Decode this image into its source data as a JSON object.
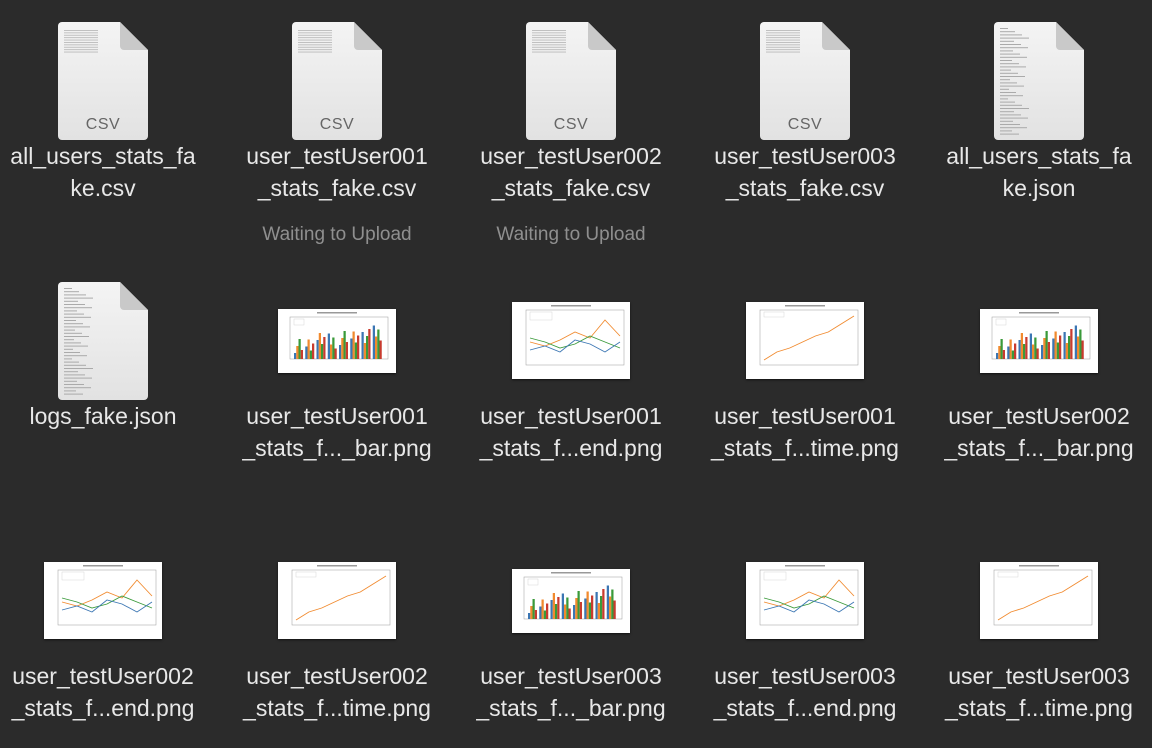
{
  "files": [
    {
      "line1": "all_users_stats_fa",
      "line2": "ke.csv",
      "kind": "csv",
      "ext": "CSV",
      "status": ""
    },
    {
      "line1": "user_testUser001",
      "line2": "_stats_fake.csv",
      "kind": "csv",
      "ext": "CSV",
      "status": "Waiting to Upload"
    },
    {
      "line1": "user_testUser002",
      "line2": "_stats_fake.csv",
      "kind": "csv",
      "ext": "CSV",
      "status": "Waiting to Upload"
    },
    {
      "line1": "user_testUser003",
      "line2": "_stats_fake.csv",
      "kind": "csv",
      "ext": "CSV",
      "status": ""
    },
    {
      "line1": "all_users_stats_fa",
      "line2": "ke.json",
      "kind": "json",
      "ext": "",
      "status": ""
    },
    {
      "line1": "logs_fake.json",
      "line2": "",
      "kind": "json",
      "ext": "",
      "status": ""
    },
    {
      "line1": "user_testUser001",
      "line2": "_stats_f..._bar.png",
      "kind": "png-bar",
      "status": ""
    },
    {
      "line1": "user_testUser001",
      "line2": "_stats_f...end.png",
      "kind": "png-trend",
      "status": ""
    },
    {
      "line1": "user_testUser001",
      "line2": "_stats_f...time.png",
      "kind": "png-time",
      "status": ""
    },
    {
      "line1": "user_testUser002",
      "line2": "_stats_f..._bar.png",
      "kind": "png-bar",
      "status": ""
    },
    {
      "line1": "user_testUser002",
      "line2": "_stats_f...end.png",
      "kind": "png-trend",
      "status": ""
    },
    {
      "line1": "user_testUser002",
      "line2": "_stats_f...time.png",
      "kind": "png-time",
      "status": ""
    },
    {
      "line1": "user_testUser003",
      "line2": "_stats_f..._bar.png",
      "kind": "png-bar",
      "status": ""
    },
    {
      "line1": "user_testUser003",
      "line2": "_stats_f...end.png",
      "kind": "png-trend",
      "status": ""
    },
    {
      "line1": "user_testUser003",
      "line2": "_stats_f...time.png",
      "kind": "png-time",
      "status": ""
    }
  ],
  "colors": {
    "background": "#2b2b2b",
    "filename": "#e8e8e8",
    "status": "#8f8f8f"
  }
}
